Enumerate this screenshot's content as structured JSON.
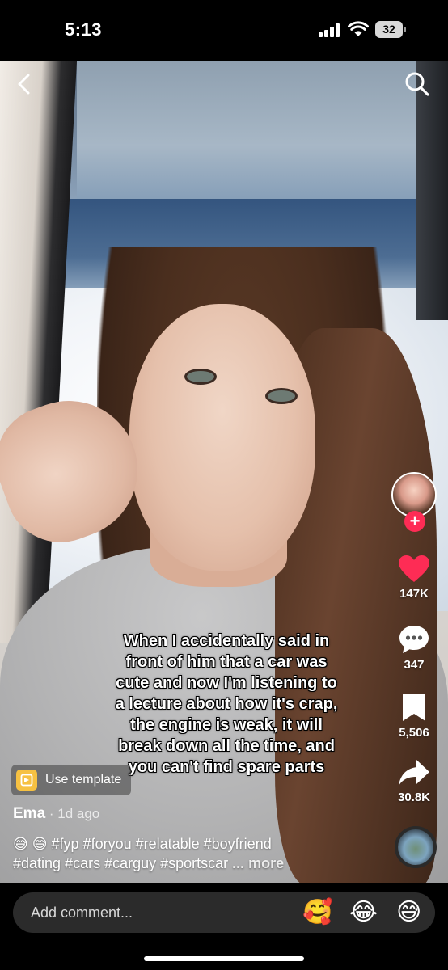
{
  "status_bar": {
    "time": "5:13",
    "battery": "32"
  },
  "icons": {
    "back": "chevron-left-icon",
    "search": "search-icon",
    "like": "heart-icon",
    "comment": "comment-bubble-icon",
    "save": "bookmark-icon",
    "share": "share-arrow-icon",
    "follow": "plus-icon",
    "template": "template-icon"
  },
  "colors": {
    "like": "#fe2c55",
    "follow": "#fe2c55",
    "template": "#f6c142"
  },
  "rail": {
    "likes": "147K",
    "comments": "347",
    "saves": "5,506",
    "shares": "30.8K",
    "follow_symbol": "+"
  },
  "caption": {
    "lines": [
      "When I accidentally said in",
      "front of him that a car was",
      "cute and now I'm listening to",
      "a lecture about how it's crap,",
      "the engine is weak, it will",
      "break down all the time, and",
      "you can't find spare parts"
    ]
  },
  "template": {
    "label": "Use template"
  },
  "post": {
    "author": "Ema",
    "separator": " · ",
    "time": "1d ago",
    "description_line1": "😅 😅 #fyp #foryou #relatable #boyfriend",
    "description_line2": "#dating #cars #carguy #sportscar",
    "more": "... more"
  },
  "comment_bar": {
    "placeholder": "Add comment...",
    "emojis": [
      "🥰",
      "😂",
      "😅"
    ]
  }
}
